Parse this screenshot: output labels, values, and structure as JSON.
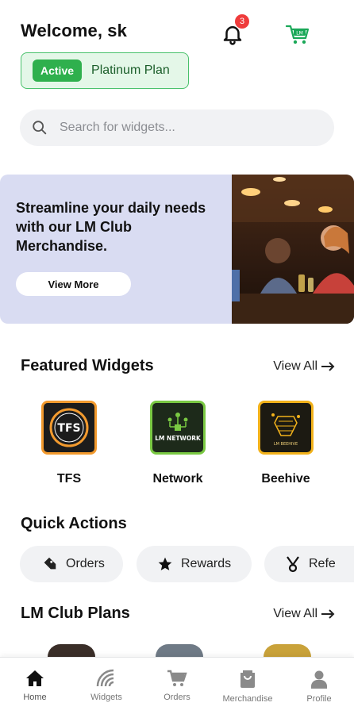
{
  "header": {
    "welcome": "Welcome, sk",
    "plan_status": "Active",
    "plan_name": "Platinum Plan",
    "notification_count": "3"
  },
  "search": {
    "placeholder": "Search for widgets..."
  },
  "banner": {
    "text": "Streamline your daily needs with our LM Club Merchandise.",
    "button": "View More"
  },
  "featured": {
    "title": "Featured Widgets",
    "view_all": "View All",
    "items": [
      {
        "label": "TFS",
        "logo_text": "TFS",
        "border_color": "#f29a2e"
      },
      {
        "label": "Network",
        "logo_text": "LM NETWORK",
        "border_color": "#7ac943"
      },
      {
        "label": "Beehive",
        "logo_text": "LM BEEHIVE",
        "border_color": "#f2b21b"
      }
    ]
  },
  "quick_actions": {
    "title": "Quick Actions",
    "items": [
      {
        "label": "Orders",
        "icon": "tag-icon"
      },
      {
        "label": "Rewards",
        "icon": "star-icon"
      },
      {
        "label": "Refe",
        "icon": "referral-icon"
      }
    ]
  },
  "plans": {
    "title": "LM Club Plans",
    "view_all": "View All"
  },
  "nav": {
    "items": [
      {
        "label": "Home",
        "icon": "home-icon"
      },
      {
        "label": "Widgets",
        "icon": "widgets-icon"
      },
      {
        "label": "Orders",
        "icon": "cart-icon"
      },
      {
        "label": "Merchandise",
        "icon": "bag-icon"
      },
      {
        "label": "Profile",
        "icon": "user-icon"
      }
    ]
  },
  "colors": {
    "accent_green": "#2fb04d",
    "banner_bg": "#d9dcf2",
    "badge_red": "#ef3b3b"
  }
}
